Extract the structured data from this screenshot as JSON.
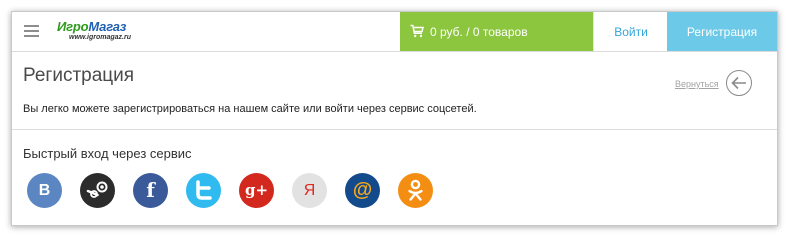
{
  "header": {
    "logo": {
      "name_part1": "Игро",
      "name_part2": "Магаз",
      "url": "www.igromagaz.ru"
    },
    "cart": {
      "text": "0 руб. / 0  товаров",
      "icon": "cart-icon"
    },
    "login_label": "Войти",
    "register_label": "Регистрация"
  },
  "main": {
    "title": "Регистрация",
    "back_label": "Вернуться",
    "description": "Вы легко можете зарегистрироваться на нашем сайте или войти через сервис соцсетей.",
    "quick_login_title": "Быстрый вход через сервис",
    "socials": [
      {
        "name": "vk",
        "glyph": "В",
        "color": "#5b86c2"
      },
      {
        "name": "steam",
        "glyph": "",
        "color": "#2c2c2c"
      },
      {
        "name": "facebook",
        "glyph": "f",
        "color": "#3b5a9a"
      },
      {
        "name": "twitter",
        "glyph": "",
        "color": "#2fbaf0"
      },
      {
        "name": "google-plus",
        "glyph": "g+",
        "color": "#d3281e"
      },
      {
        "name": "yandex",
        "glyph": "Я",
        "color": "#e2e2e2"
      },
      {
        "name": "mail",
        "glyph": "@",
        "color": "#134a8b"
      },
      {
        "name": "odnoklassniki",
        "glyph": "",
        "color": "#f38e13"
      }
    ]
  }
}
